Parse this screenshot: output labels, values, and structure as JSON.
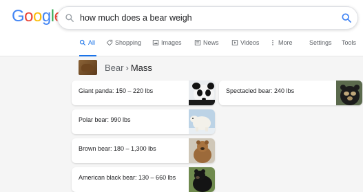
{
  "logo": "Google",
  "search": {
    "query": "how much does a bear weigh"
  },
  "tabs": [
    {
      "label": "All",
      "icon": "search-icon"
    },
    {
      "label": "Shopping",
      "icon": "tag-icon"
    },
    {
      "label": "Images",
      "icon": "image-icon"
    },
    {
      "label": "News",
      "icon": "news-icon"
    },
    {
      "label": "Videos",
      "icon": "play-icon"
    },
    {
      "label": "More",
      "icon": "more-vertical-icon"
    },
    {
      "label": "Settings"
    },
    {
      "label": "Tools"
    }
  ],
  "breadcrumb": {
    "parent": "Bear",
    "separator": "›",
    "current": "Mass"
  },
  "cards": [
    {
      "text": "Giant panda: 150 – 220 lbs",
      "image": "giant-panda"
    },
    {
      "text": "Spectacled bear: 240 lbs",
      "image": "spectacled-bear"
    },
    {
      "text": "Polar bear: 990 lbs",
      "image": "polar-bear"
    },
    {
      "text": "Brown bear: 180 – 1,300 lbs",
      "image": "brown-bear"
    },
    {
      "text": "American black bear: 130 – 660 lbs",
      "image": "american-black-bear"
    }
  ],
  "colors": {
    "accent": "#1a73e8",
    "page_bg": "#f5f5f5",
    "text": "#202124",
    "muted": "#5f6368"
  }
}
